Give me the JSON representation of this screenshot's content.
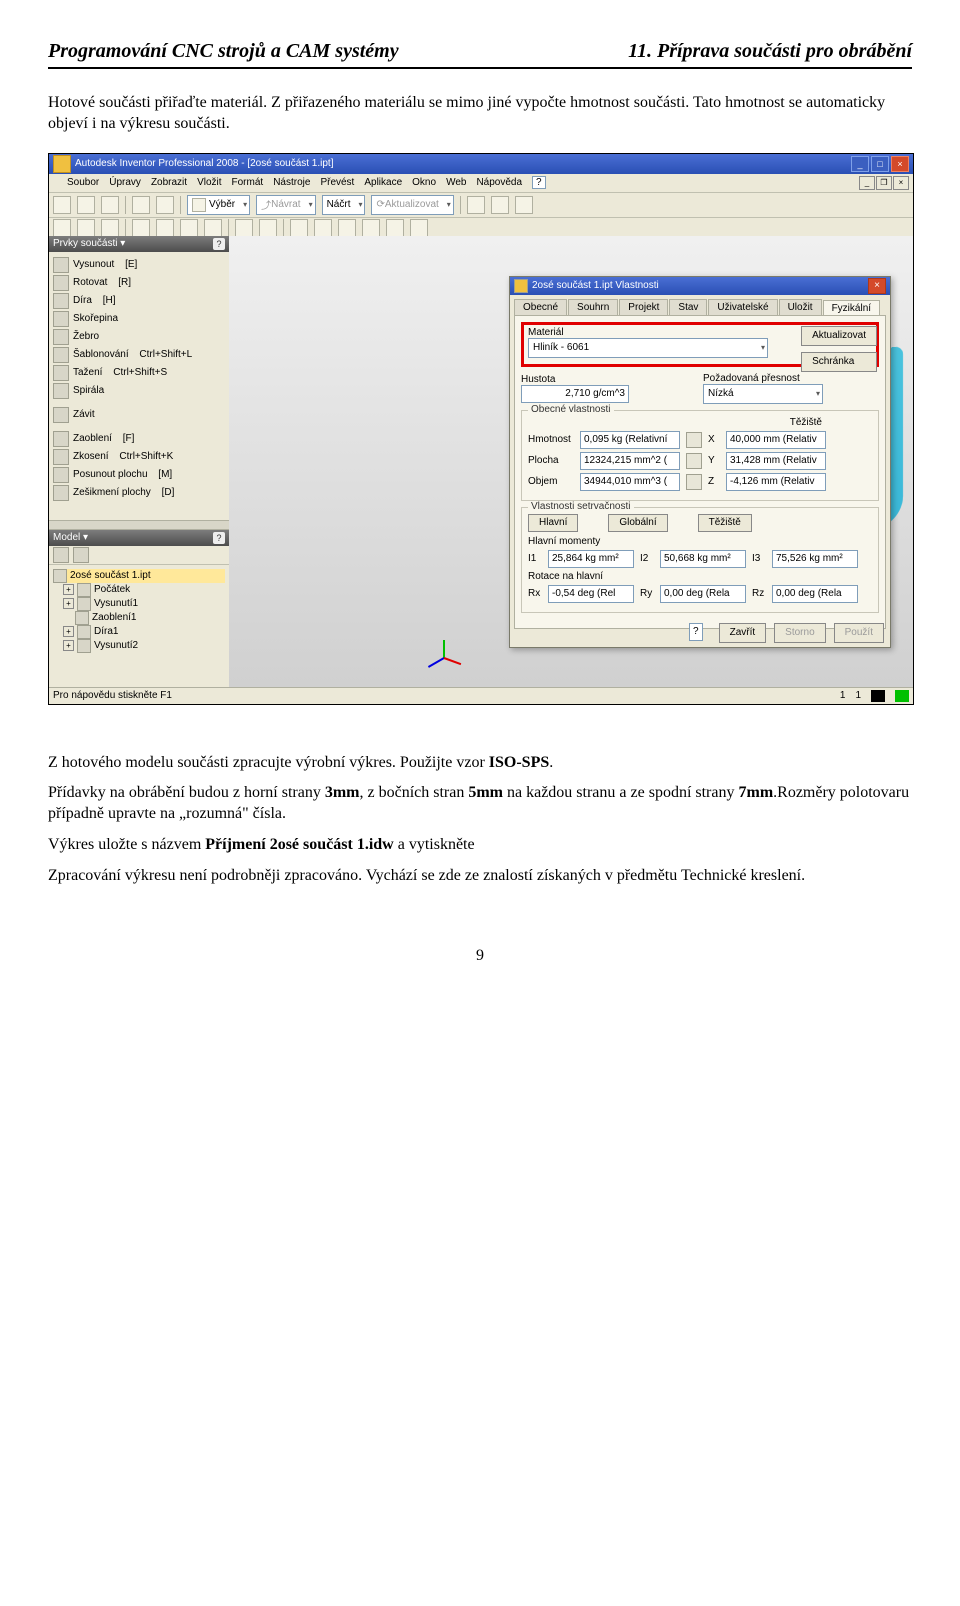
{
  "header": {
    "left": "Programování CNC strojů a CAM systémy",
    "right": "11. Příprava součásti pro obrábění"
  },
  "para1_a": "Hotové součásti přiřaďte materiál. Z přiřazeného materiálu se mimo jiné vypočte hmotnost součásti. Tato hmotnost se automaticky objeví i na výkresu součásti.",
  "para2_a": "Z hotového modelu součásti zpracujte výrobní výkres. Použijte vzor ",
  "para2_b": "ISO-SPS",
  "para2_c": ".",
  "para3_a": "Přídavky na obrábění budou z horní strany ",
  "para3_b": "3mm",
  "para3_c": ", z bočních stran ",
  "para3_d": "5mm",
  "para3_e": " na každou stranu a ze spodní strany ",
  "para3_f": "7mm",
  "para3_g": ".Rozměry polotovaru případně upravte na „rozumná\" čísla.",
  "para4_a": "Výkres uložte s názvem ",
  "para4_b": "Příjmení 2osé součást 1.idw",
  "para4_c": " a vytiskněte",
  "para5": "Zpracování výkresu není podrobněji zpracováno. Vychází se zde ze znalostí získaných v předmětu Technické kreslení.",
  "pageNumber": "9",
  "app": {
    "title": "Autodesk Inventor Professional 2008 - [2osé součást 1.ipt]",
    "menus": [
      "Soubor",
      "Úpravy",
      "Zobrazit",
      "Vložit",
      "Formát",
      "Nástroje",
      "Převést",
      "Aplikace",
      "Okno",
      "Web",
      "Nápověda"
    ],
    "helpGlyph": "?",
    "toolbar": {
      "select_label": "Výběr",
      "return_label": "Návrat",
      "sketch_label": "Náčrt",
      "update_label": "Aktualizovat"
    },
    "panel1_header": "Prvky součásti ▾",
    "features": [
      {
        "label": "Vysunout",
        "key": "[E]"
      },
      {
        "label": "Rotovat",
        "key": "[R]"
      },
      {
        "label": "Díra",
        "key": "[H]"
      },
      {
        "label": "Skořepina",
        "key": ""
      },
      {
        "label": "Žebro",
        "key": ""
      },
      {
        "label": "Šablonování",
        "key": "Ctrl+Shift+L"
      },
      {
        "label": "Tažení",
        "key": "Ctrl+Shift+S"
      },
      {
        "label": "Spirála",
        "key": ""
      },
      {
        "label": "Závit",
        "key": ""
      },
      {
        "label": "Zaoblení",
        "key": "[F]"
      },
      {
        "label": "Zkosení",
        "key": "Ctrl+Shift+K"
      },
      {
        "label": "Posunout plochu",
        "key": "[M]"
      },
      {
        "label": "Zešikmení plochy",
        "key": "[D]"
      }
    ],
    "model_header": "Model ▾",
    "tree": [
      "2osé součást 1.ipt",
      "Počátek",
      "Vysunutí1",
      "Zaoblení1",
      "Díra1",
      "Vysunutí2"
    ],
    "statusbar_left": "Pro nápovědu stiskněte F1",
    "statusbar_nums": [
      "1",
      "1"
    ]
  },
  "dialog": {
    "title": "2osé součást 1.ipt Vlastnosti",
    "tabs": [
      "Obecné",
      "Souhrn",
      "Projekt",
      "Stav",
      "Uživatelské",
      "Uložit",
      "Fyzikální"
    ],
    "material_label": "Materiál",
    "material_value": "Hliník - 6061",
    "update_btn": "Aktualizovat",
    "density_label": "Hustota",
    "density_value": "2,710 g/cm^3",
    "precision_label": "Požadovaná přesnost",
    "precision_value": "Nízká",
    "clipboard_btn": "Schránka",
    "general_props": "Obecné vlastnosti",
    "centroid": "Těžiště",
    "mass_label": "Hmotnost",
    "mass_value": "0,095 kg (Relativní",
    "x_label": "X",
    "x_value": "40,000 mm (Relativ",
    "area_label": "Plocha",
    "area_value": "12324,215 mm^2 (",
    "y_label": "Y",
    "y_value": "31,428 mm (Relativ",
    "volume_label": "Objem",
    "volume_value": "34944,010 mm^3 (",
    "z_label": "Z",
    "z_value": "-4,126 mm (Relativ",
    "inertia_label": "Vlastnosti setrvačnosti",
    "inertia_tabs": [
      "Hlavní",
      "Globální",
      "Těžiště"
    ],
    "moments_label": "Hlavní momenty",
    "i1_label": "I1",
    "i1_value": "25,864 kg mm²",
    "i2_label": "I2",
    "i2_value": "50,668 kg mm²",
    "i3_label": "I3",
    "i3_value": "75,526 kg mm²",
    "rotation_label": "Rotace na hlavní",
    "rx_label": "Rx",
    "rx_value": "-0,54 deg (Rel",
    "ry_label": "Ry",
    "ry_value": "0,00 deg (Rela",
    "rz_label": "Rz",
    "rz_value": "0,00 deg (Rela",
    "close_btn": "Zavřít",
    "cancel_btn": "Storno",
    "apply_btn": "Použít",
    "qm": "?"
  }
}
